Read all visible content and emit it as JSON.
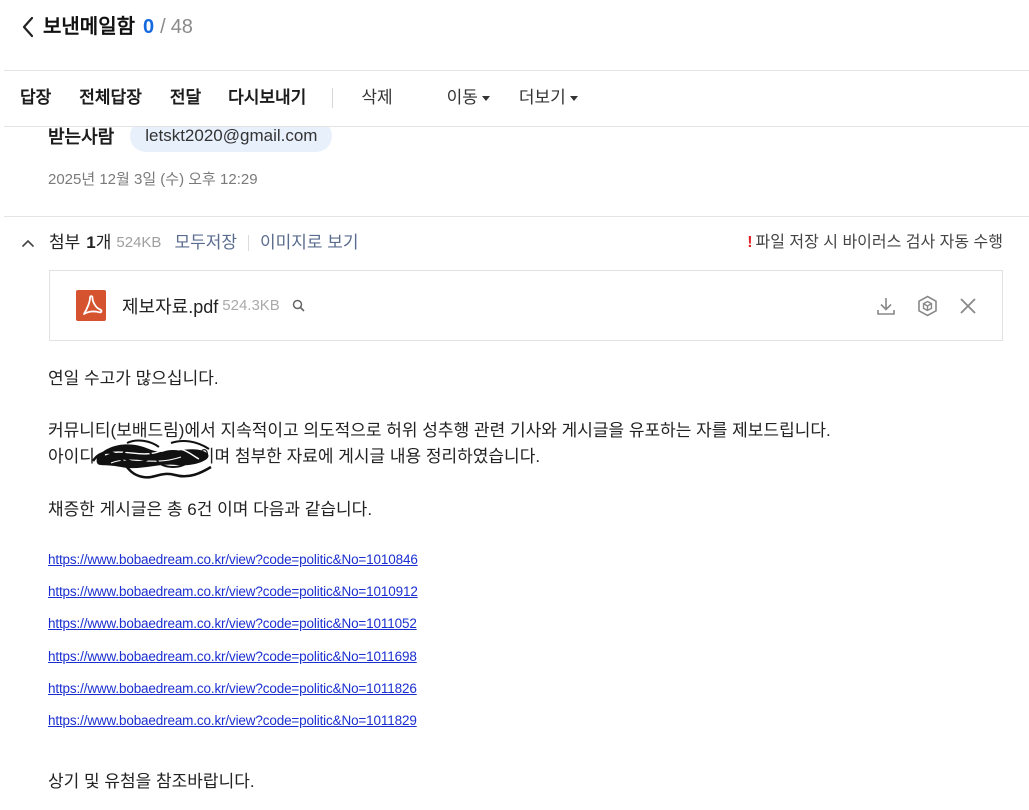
{
  "header": {
    "back_icon": "chevron-left-icon",
    "title": "보낸메일함",
    "current": "0",
    "separator": "/",
    "total": "48"
  },
  "toolbar": {
    "reply": "답장",
    "reply_all": "전체답장",
    "forward": "전달",
    "resend": "다시보내기",
    "delete": "삭제",
    "move": "이동",
    "more": "더보기",
    "dropdown_icon": "caret-down-icon"
  },
  "recipient": {
    "label": "받는사람",
    "email": "letskt2020@gmail.com"
  },
  "sent_date": "2025년 12월 3일 (수) 오후 12:29",
  "attachments": {
    "toggle_icon": "chevron-up-icon",
    "label": "첨부",
    "count": "1",
    "unit": "개",
    "total_size": "524KB",
    "save_all": "모두저장",
    "view_as_image": "이미지로 보기",
    "warning_mark": "!",
    "virus_notice": "파일 저장 시 바이러스 검사 자동 수행",
    "files": [
      {
        "name": "제보자료.pdf",
        "size": "524.3KB",
        "icon": "pdf-file-icon",
        "actions": [
          "search-icon",
          "download-icon",
          "cube-icon",
          "close-icon"
        ]
      }
    ]
  },
  "body": {
    "greeting": "연일 수고가 많으십니다.",
    "report_line": "커뮤니티(보배드림)에서 지속적이고 의도적으로 허위 성추행 관련 기사와 게시글을 유포하는 자를 제보드립니다.",
    "id_prefix": "아이디",
    "id_suffix": "이며 첨부한 자료에 게시글 내용 정리하였습니다.",
    "evidence_line": "채증한 게시글은 총 6건 이며 다음과 같습니다.",
    "links": [
      "https://www.bobaedream.co.kr/view?code=politic&No=1010846",
      "https://www.bobaedream.co.kr/view?code=politic&No=1010912",
      "https://www.bobaedream.co.kr/view?code=politic&No=1011052",
      "https://www.bobaedream.co.kr/view?code=politic&No=1011698",
      "https://www.bobaedream.co.kr/view?code=politic&No=1011826",
      "https://www.bobaedream.co.kr/view?code=politic&No=1011829"
    ],
    "closing": "상기 및 유첨을 참조바랍니다."
  },
  "colors": {
    "accent": "#1769e0",
    "link": "#1b2fd0",
    "secondary_link": "#5a6c8e",
    "warning": "#e3262c",
    "pdf_badge": "#d6532f",
    "chip_bg": "#e8f0fc",
    "muted": "#8a8a8a"
  }
}
